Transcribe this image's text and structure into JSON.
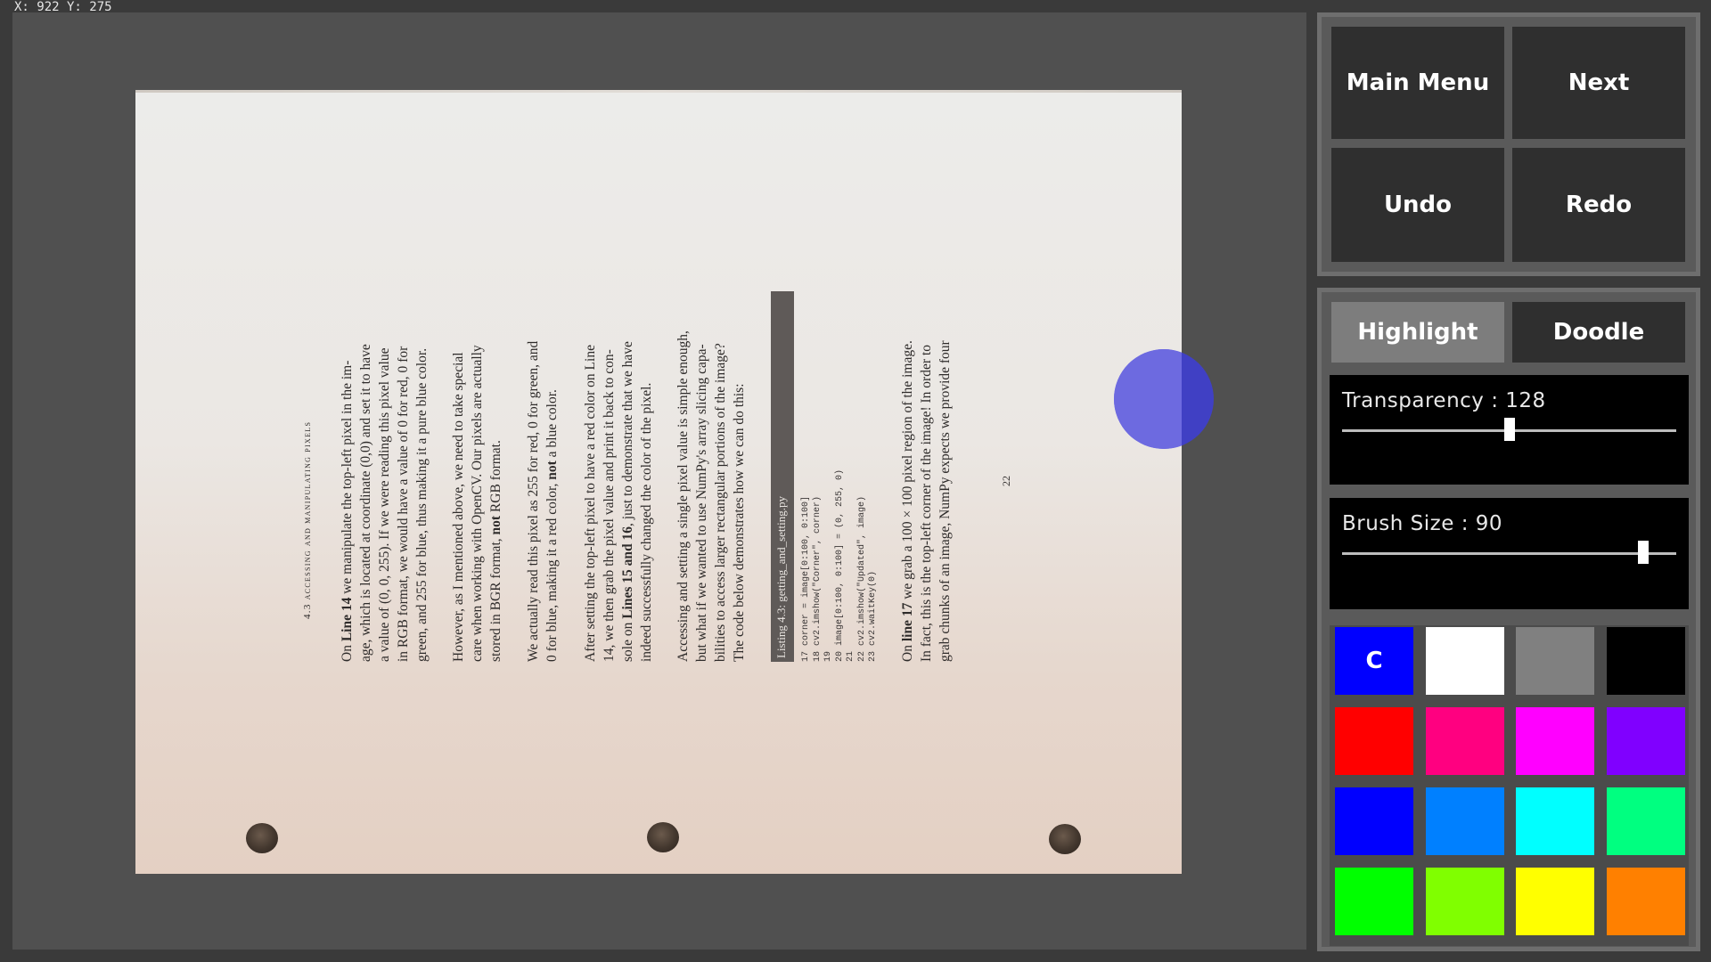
{
  "cursor_readout": "X: 922 Y: 275",
  "document": {
    "running_head": "4.3 accessing and manipulating pixels",
    "page_number": "22",
    "paragraph1": [
      "On Line 14 we manipulate the top-left pixel in the im-",
      "age, which is located at coordinate (0,0) and set it to have",
      "a value of (0, 0, 255). If we were reading this pixel value",
      "in RGB format, we would have a value of 0 for red, 0 for",
      "green, and 255 for blue, thus making it a pure blue color."
    ],
    "paragraph2": [
      "However, as I mentioned above, we need to take special",
      "care when working with OpenCV. Our pixels are actually",
      "stored in BGR format, not RGB format."
    ],
    "paragraph3": [
      "We actually read this pixel as 255 for red, 0 for green, and",
      "0 for blue, making it a red color, not a blue color."
    ],
    "paragraph4": [
      "After setting the top-left pixel to have a red color on Line",
      "14, we then grab the pixel value and print it back to con-",
      "sole on Lines 15 and 16, just to demonstrate that we have",
      "indeed successfully changed the color of the pixel."
    ],
    "paragraph5": [
      "Accessing and setting a single pixel value is simple enough,",
      "but what if we wanted to use NumPy's array slicing capa-",
      "bilities to access larger rectangular portions of the image?",
      "The code below demonstrates how we can do this:"
    ],
    "listing_title": "Listing 4.3: getting_and_setting.py",
    "code_lines": [
      "17 corner = image[0:100, 0:100]",
      "18 cv2.imshow(\"Corner\", corner)",
      "19",
      "20 image[0:100, 0:100] = (0, 255, 0)",
      "21",
      "22 cv2.imshow(\"Updated\", image)",
      "23 cv2.waitKey(0)"
    ],
    "paragraph6": [
      "On line 17 we grab a 100 × 100 pixel region of the image.",
      "In fact, this is the top-left corner of the image! In order to",
      "grab chunks of an image, NumPy expects we provide four"
    ]
  },
  "nav": {
    "main_menu": "Main  Menu",
    "next": "Next",
    "undo": "Undo",
    "redo": "Redo"
  },
  "tools": {
    "highlight": "Highlight",
    "doodle": "Doodle",
    "active_tool": "Highlight"
  },
  "transparency": {
    "label": "Transparency : 128",
    "value": 128,
    "max": 255
  },
  "brush_size": {
    "label": "Brush Size : 90",
    "value": 90,
    "max": 100
  },
  "palette": {
    "selected_marker": "C",
    "selected_index": 0,
    "colors": [
      "#0000ff",
      "#ffffff",
      "#808080",
      "#000000",
      "#ff0000",
      "#ff0080",
      "#ff00ff",
      "#8000ff",
      "#0000ff",
      "#0080ff",
      "#00ffff",
      "#00ff80",
      "#00ff00",
      "#80ff00",
      "#ffff00",
      "#ff8000"
    ]
  },
  "brush_color": "#3c3ce6"
}
